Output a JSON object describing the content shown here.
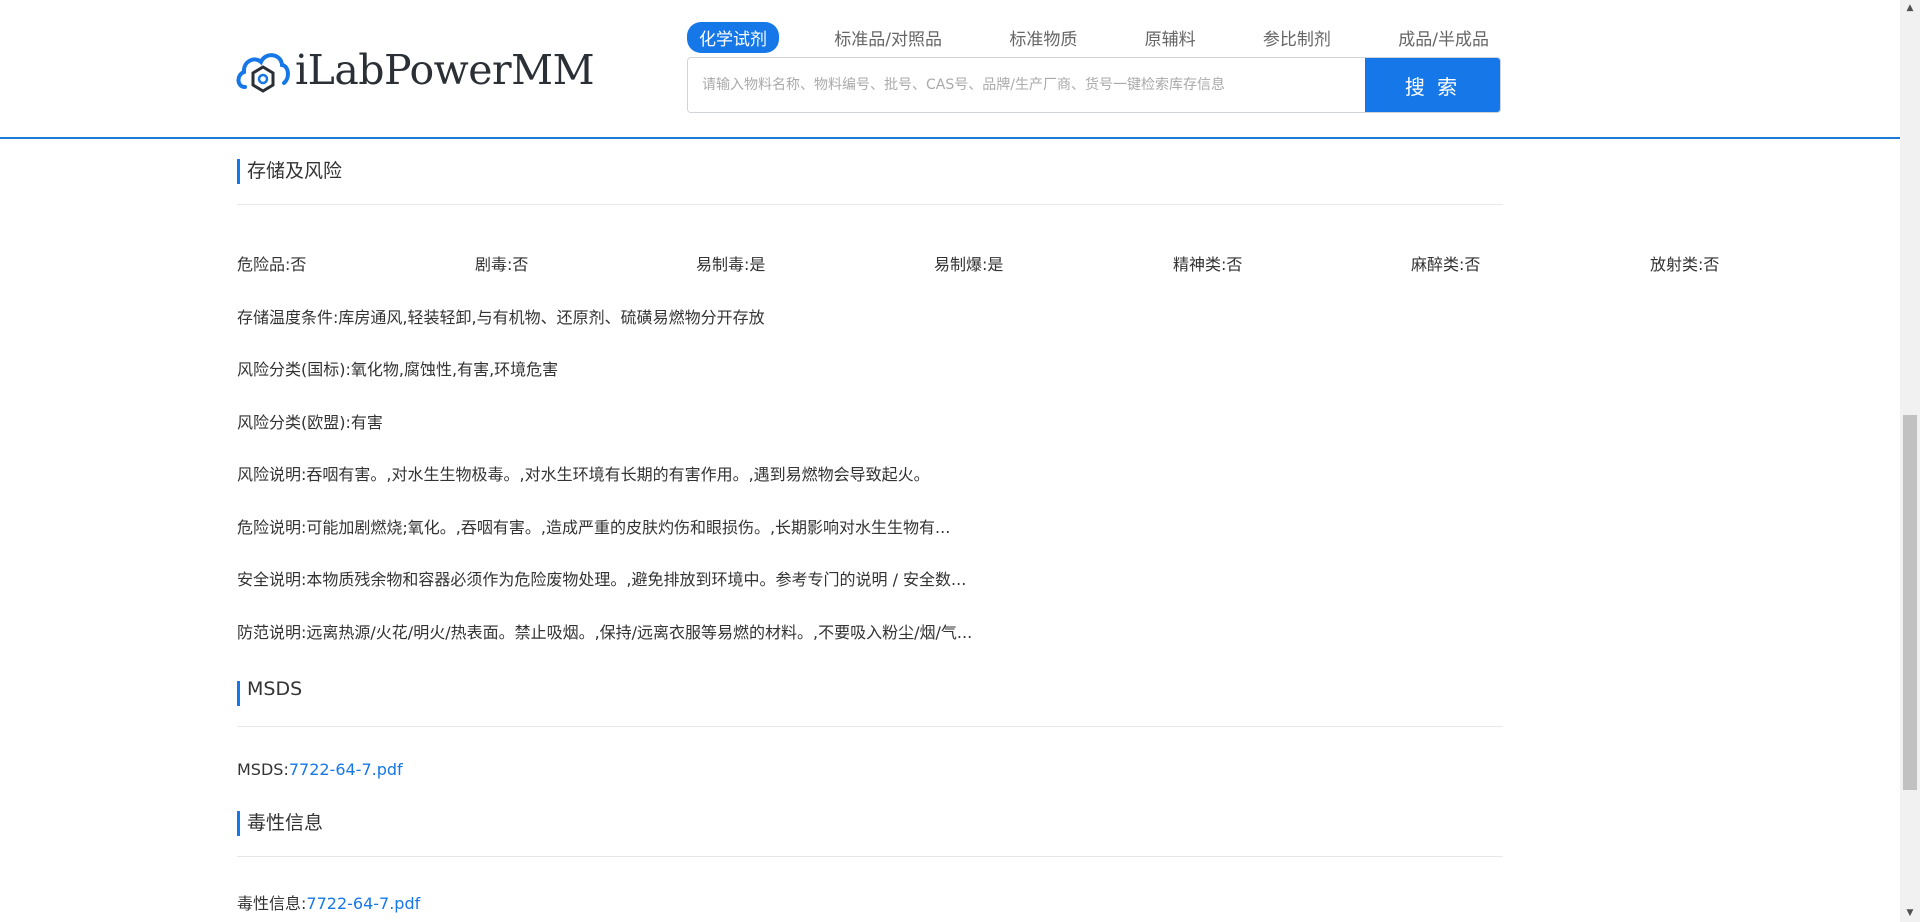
{
  "header": {
    "logo_text": "iLabPowerMM",
    "tabs": [
      "化学试剂",
      "标准品/对照品",
      "标准物质",
      "原辅料",
      "参比制剂",
      "成品/半成品"
    ],
    "search": {
      "placeholder": "请输入物料名称、物料编号、批号、CAS号、品牌/生产厂商、货号一键检索库存信息",
      "value": "",
      "button_label": "搜 索"
    },
    "accent_color": "#1677e8"
  },
  "storage_risk": {
    "title": "存储及风险",
    "flags": [
      {
        "label": "危险品:",
        "value": "否"
      },
      {
        "label": "剧毒:",
        "value": "否"
      },
      {
        "label": "易制毒:",
        "value": "是"
      },
      {
        "label": "易制爆:",
        "value": "是"
      },
      {
        "label": "精神类:",
        "value": "否"
      },
      {
        "label": "麻醉类:",
        "value": "否"
      },
      {
        "label": "放射类:",
        "value": "否"
      }
    ],
    "storage_condition": {
      "label": "存储温度条件:",
      "value": "库房通风,轻装轻卸,与有机物、还原剂、硫磺易燃物分开存放"
    },
    "risk_class_gb": {
      "label": "风险分类(国标):",
      "value": "氧化物,腐蚀性,有害,环境危害"
    },
    "risk_class_eu": {
      "label": "风险分类(欧盟):",
      "value": "有害"
    },
    "risk_statement": {
      "label": "风险说明:",
      "value": "吞咽有害。,对水生生物极毒。,对水生环境有长期的有害作用。,遇到易燃物会导致起火。"
    },
    "hazard_statement": {
      "label": "危险说明:",
      "value": "可能加剧燃烧;氧化。,吞咽有害。,造成严重的皮肤灼伤和眼损伤。,长期影响对水生生物有..."
    },
    "safety_statement": {
      "label": "安全说明:",
      "value": "本物质残余物和容器必须作为危险废物处理。,避免排放到环境中。参考专门的说明 / 安全数..."
    },
    "precaution_statement": {
      "label": "防范说明:",
      "value": "远离热源/火花/明火/热表面。禁止吸烟。,保持/远离衣服等易燃的材料。,不要吸入粉尘/烟/气..."
    }
  },
  "msds": {
    "title": "MSDS",
    "label": "MSDS:",
    "file": "7722-64-7.pdf"
  },
  "toxicity": {
    "title": "毒性信息",
    "label": "毒性信息:",
    "file": "7722-64-7.pdf"
  }
}
